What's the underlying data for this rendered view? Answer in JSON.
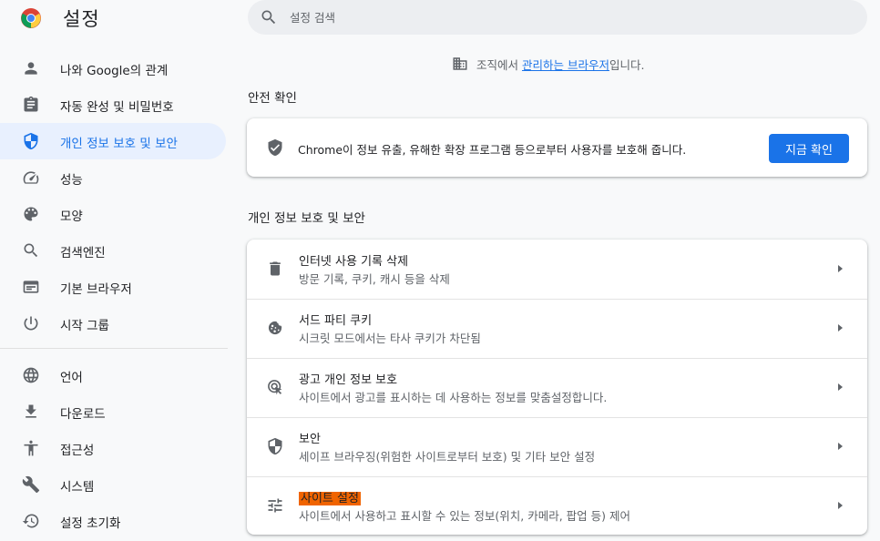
{
  "header": {
    "title": "설정"
  },
  "search": {
    "placeholder": "설정 검색"
  },
  "sidebar": {
    "items": [
      {
        "label": "나와 Google의 관계",
        "icon": "person-icon"
      },
      {
        "label": "자동 완성 및 비밀번호",
        "icon": "clipboard-icon"
      },
      {
        "label": "개인 정보 보호 및 보안",
        "icon": "shield-icon",
        "active": true
      },
      {
        "label": "성능",
        "icon": "speedometer-icon"
      },
      {
        "label": "모양",
        "icon": "palette-icon"
      },
      {
        "label": "검색엔진",
        "icon": "search-icon"
      },
      {
        "label": "기본 브라우저",
        "icon": "browser-icon"
      },
      {
        "label": "시작 그룹",
        "icon": "power-icon"
      },
      {
        "label": "언어",
        "icon": "globe-icon"
      },
      {
        "label": "다운로드",
        "icon": "download-icon"
      },
      {
        "label": "접근성",
        "icon": "accessibility-icon"
      },
      {
        "label": "시스템",
        "icon": "wrench-icon"
      },
      {
        "label": "설정 초기화",
        "icon": "history-icon"
      }
    ]
  },
  "managed": {
    "prefix": "조직에서 ",
    "link": "관리하는 브라우저",
    "suffix": "입니다."
  },
  "safety": {
    "section_title": "안전 확인",
    "text": "Chrome이 정보 유출, 유해한 확장 프로그램 등으로부터 사용자를 보호해 줍니다.",
    "button": "지금 확인"
  },
  "privacy": {
    "section_title": "개인 정보 보호 및 보안",
    "rows": [
      {
        "title": "인터넷 사용 기록 삭제",
        "subtitle": "방문 기록, 쿠키, 캐시 등을 삭제",
        "icon": "trash-icon"
      },
      {
        "title": "서드 파티 쿠키",
        "subtitle": "시크릿 모드에서는 타사 쿠키가 차단됨",
        "icon": "cookie-icon"
      },
      {
        "title": "광고 개인 정보 보호",
        "subtitle": "사이트에서 광고를 표시하는 데 사용하는 정보를 맞춤설정합니다.",
        "icon": "ad-privacy-icon"
      },
      {
        "title": "보안",
        "subtitle": "세이프 브라우징(위험한 사이트로부터 보호) 및 기타 보안 설정",
        "icon": "security-shield-icon"
      },
      {
        "title": "사이트 설정",
        "subtitle": "사이트에서 사용하고 표시할 수 있는 정보(위치, 카메라, 팝업 등) 제어",
        "icon": "tune-icon",
        "highlighted": true
      }
    ]
  },
  "colors": {
    "accent": "#1a73e8",
    "active_bg": "#e8f0fe",
    "highlight": "#f06400"
  }
}
